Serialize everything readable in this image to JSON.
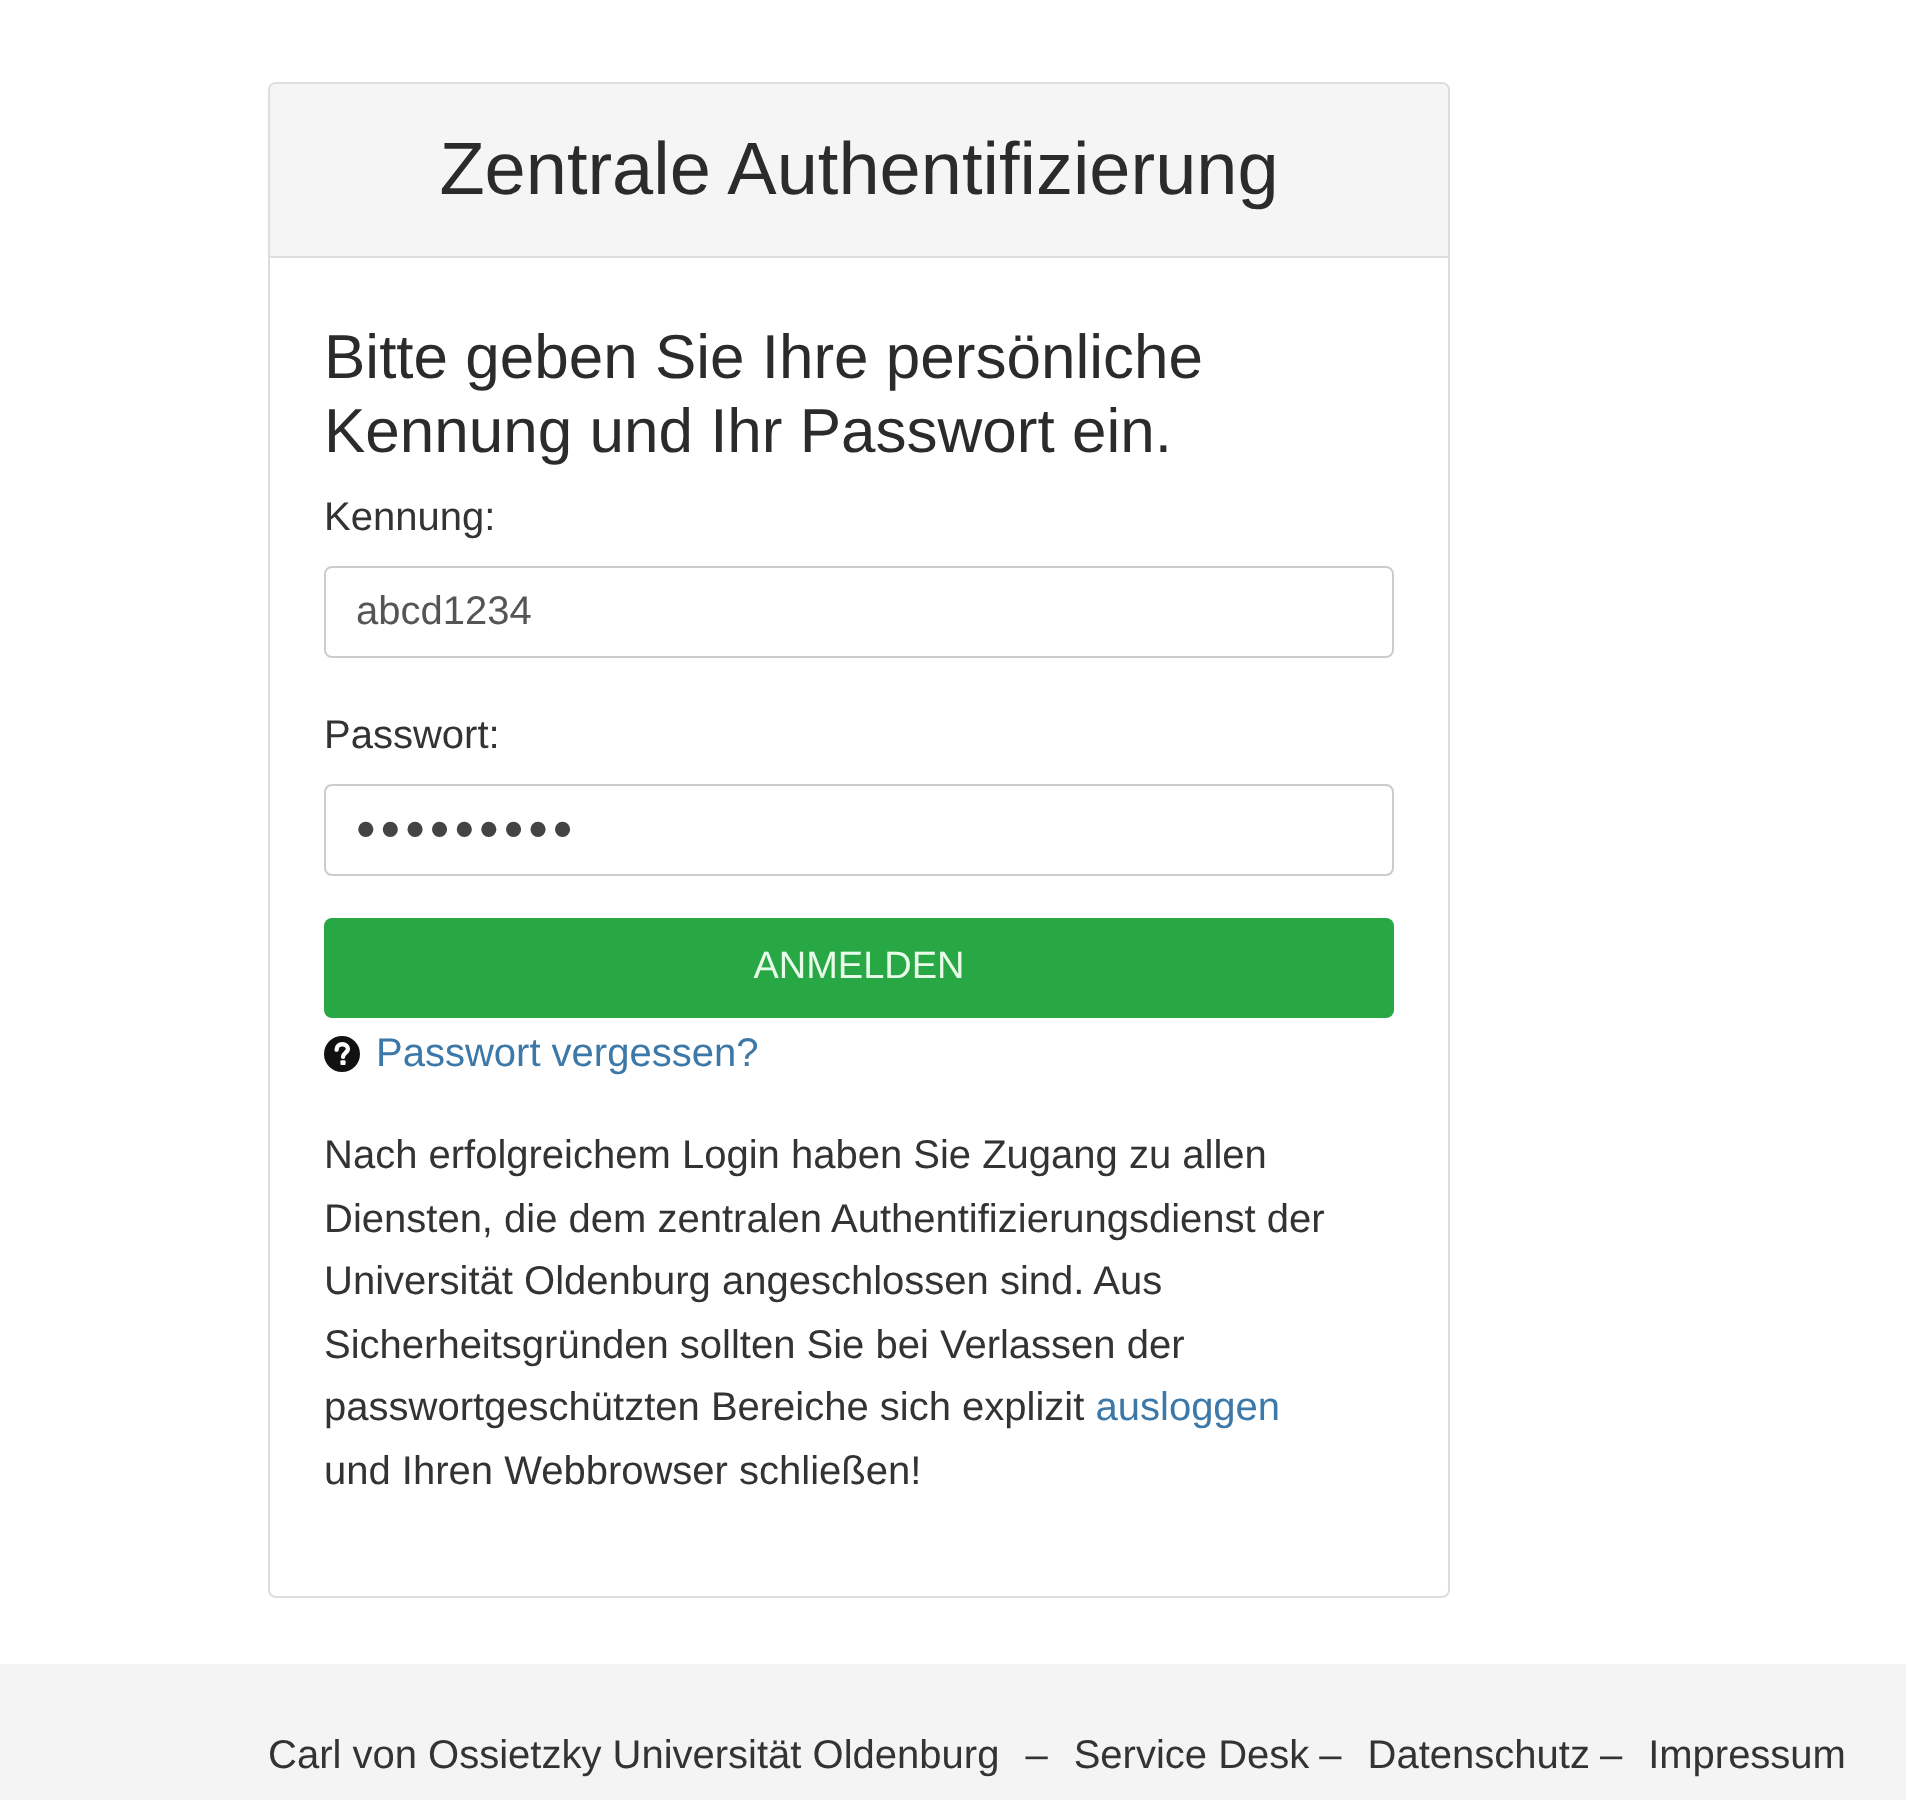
{
  "card": {
    "title": "Zentrale Authentifizierung",
    "heading": "Bitte geben Sie Ihre persönliche Kennung und Ihr Passwort ein.",
    "fields": [
      {
        "kind": "text",
        "label": "Kennung:",
        "value": "abcd1234"
      },
      {
        "kind": "password",
        "label": "Passwort:",
        "value": "•••••••••"
      }
    ],
    "submit_button": "ANMELDEN",
    "forgot_link": "Passwort vergessen?",
    "notice": {
      "text_before": "Nach erfolgreichem Login haben Sie Zugang zu allen Diensten, die dem zentralen Authentifizierungsdienst der Universität Oldenburg angeschlossen sind. Aus Sicherheitsgründen sollten Sie bei Verlassen der passwortgeschützten Bereiche sich explizit",
      "link": "ausloggen",
      "text_after": "und Ihren Webbrowser schließen!"
    }
  },
  "footer": {
    "items": [
      {
        "kind": "text",
        "label": "Carl von Ossietzky Universität Oldenburg"
      },
      {
        "kind": "separator",
        "label": "–"
      },
      {
        "kind": "link",
        "label": "Service Desk"
      },
      {
        "kind": "separator",
        "label": "–"
      },
      {
        "kind": "link",
        "label": "Datenschutz"
      },
      {
        "kind": "separator",
        "label": "–"
      },
      {
        "kind": "link",
        "label": "Impressum"
      }
    ]
  }
}
